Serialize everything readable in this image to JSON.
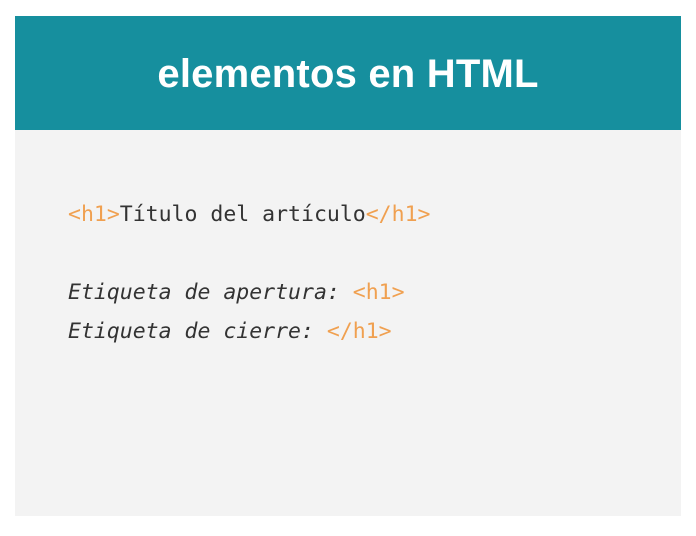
{
  "header": {
    "title": "elementos en HTML"
  },
  "example": {
    "open_tag": "<h1>",
    "content": "Título del artículo",
    "close_tag": "</h1>"
  },
  "opening": {
    "label": "Etiqueta de apertura: ",
    "tag": "<h1>"
  },
  "closing": {
    "label": "Etiqueta de cierre: ",
    "tag": "</h1>"
  },
  "colors": {
    "header_bg": "#168f9e",
    "tag_color": "#f0a050",
    "text_color": "#333333",
    "card_bg": "#f3f3f3"
  }
}
